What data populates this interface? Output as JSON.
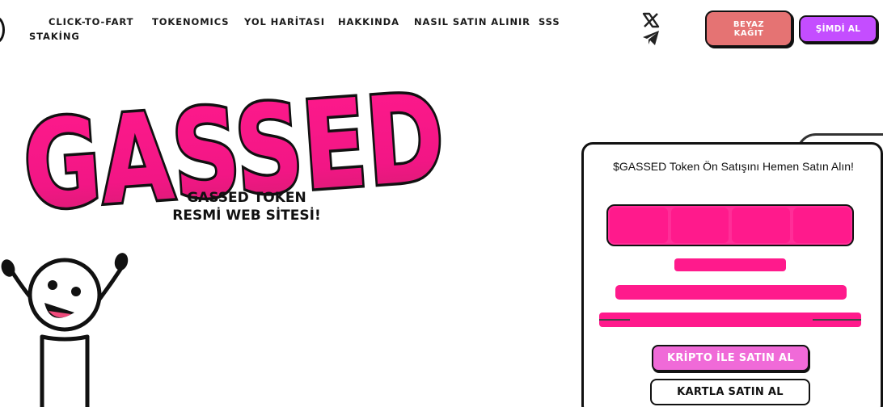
{
  "header": {
    "nav": [
      {
        "label": "CLICK-TO-FART",
        "name": "nav-click-to-fart"
      },
      {
        "label": "TOKENOMICS",
        "name": "nav-tokenomics"
      },
      {
        "label": "YOL HARİTASI",
        "name": "nav-yol-haritasi"
      },
      {
        "label": "HAKKINDA",
        "name": "nav-hakkinda"
      },
      {
        "label": "NASIL SATIN ALINIR",
        "name": "nav-nasil-satin-alinir"
      },
      {
        "label": "SSS",
        "name": "nav-sss"
      },
      {
        "label": "STAKİNG",
        "name": "nav-staking"
      }
    ],
    "social_icons": [
      "x-icon",
      "telegram-icon"
    ],
    "whitepaper_label": "BEYAZ KAĞIT",
    "buy_now_label": "ŞİMDİ AL"
  },
  "hero": {
    "logo_text": "GASSED",
    "subtitle_line1": "GASSED TOKEN",
    "subtitle_line2": "RESMİ WEB SİTESİ!"
  },
  "presale": {
    "title": "$GASSED Token Ön Satışını Hemen Satın Alın!",
    "crypto_button": "KRİPTO İLE SATIN AL",
    "card_button": "KARTLA SATIN AL"
  },
  "colors": {
    "brand_pink": "#ff1a8c",
    "purple": "#c44dff",
    "salmon": "#e57373",
    "crypto_pink": "#f06ad8"
  }
}
